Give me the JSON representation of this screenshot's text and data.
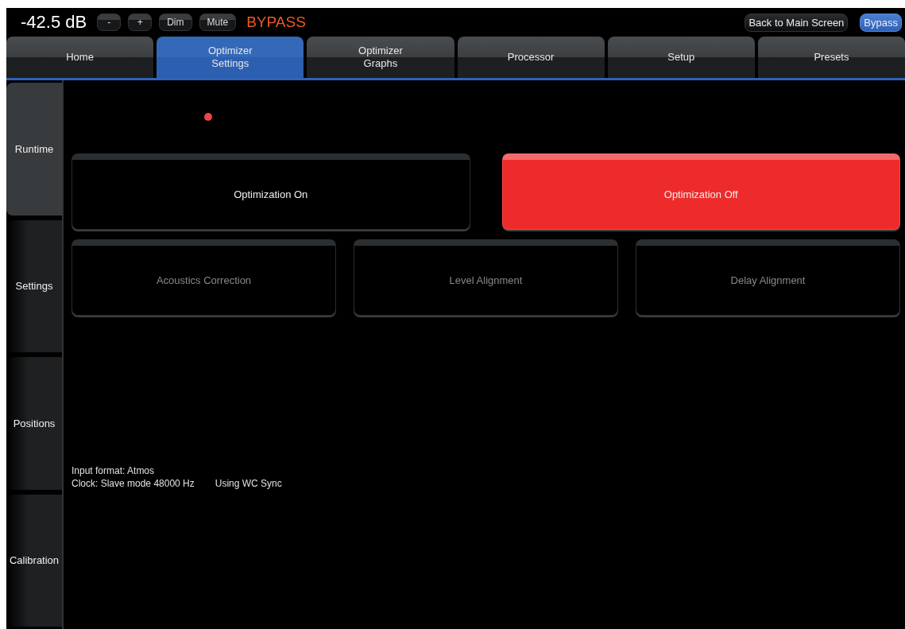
{
  "header": {
    "volume": "-42.5 dB",
    "controls": [
      {
        "label": "-"
      },
      {
        "label": "+"
      },
      {
        "label": "Dim"
      },
      {
        "label": "Mute"
      }
    ],
    "status": "BYPASS",
    "right_buttons": [
      {
        "label": "Back to Main Screen",
        "active": false
      },
      {
        "label": "Bypass",
        "active": true
      }
    ]
  },
  "tabs": [
    {
      "label": "Home",
      "selected": false
    },
    {
      "label": "Optimizer\nSettings",
      "selected": true
    },
    {
      "label": "Optimizer\nGraphs",
      "selected": false
    },
    {
      "label": "Processor",
      "selected": false
    },
    {
      "label": "Setup",
      "selected": false
    },
    {
      "label": "Presets",
      "selected": false
    }
  ],
  "sidebar": {
    "items": [
      {
        "label": "Runtime",
        "selected": true
      },
      {
        "label": "Settings",
        "selected": false
      },
      {
        "label": "Positions",
        "selected": false
      },
      {
        "label": "Calibration",
        "selected": false
      }
    ]
  },
  "optimization": [
    {
      "label": "Optimization On",
      "selected": false
    },
    {
      "label": "Optimization Off",
      "selected": true
    }
  ],
  "modules": [
    {
      "label": "Acoustics Correction",
      "disabled": true
    },
    {
      "label": "Level Alignment",
      "disabled": true
    },
    {
      "label": "Delay Alignment",
      "disabled": true
    }
  ],
  "info": {
    "input_format": "Input format: Atmos",
    "clock": "Clock: Slave mode 48000 Hz",
    "sync": "Using WC Sync"
  }
}
